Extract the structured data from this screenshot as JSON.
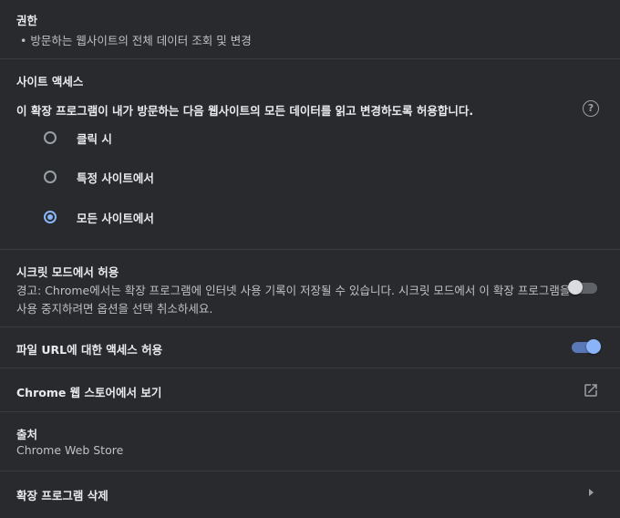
{
  "permissions": {
    "title": "권한",
    "items": [
      "방문하는 웹사이트의 전체 데이터 조회 및 변경"
    ]
  },
  "site_access": {
    "title": "사이트 액세스",
    "description": "이 확장 프로그램이 내가 방문하는 다음 웹사이트의 모든 데이터를 읽고 변경하도록 허용합니다.",
    "help_icon": "help-circle-icon",
    "options": [
      {
        "label": "클릭 시",
        "selected": false
      },
      {
        "label": "특정 사이트에서",
        "selected": false
      },
      {
        "label": "모든 사이트에서",
        "selected": true
      }
    ]
  },
  "incognito": {
    "title": "시크릿 모드에서 허용",
    "warning_line1": "경고: Chrome에서는 확장 프로그램에 인터넷 사용 기록이 저장될 수 있습니다. 시크릿 모드에서 이 확장 프로그램을",
    "warning_line2": "사용 중지하려면 옵션을 선택 취소하세요.",
    "enabled": false
  },
  "file_urls": {
    "title": "파일 URL에 대한 액세스 허용",
    "enabled": true
  },
  "web_store": {
    "title": "Chrome 웹 스토어에서 보기",
    "icon": "open-in-new-icon"
  },
  "source": {
    "title": "출처",
    "value": "Chrome Web Store"
  },
  "remove": {
    "title": "확장 프로그램 삭제",
    "icon": "chevron-right-icon"
  },
  "colors": {
    "background": "#292a2d",
    "accent": "#8ab4f8",
    "divider": "#3c3d41"
  }
}
